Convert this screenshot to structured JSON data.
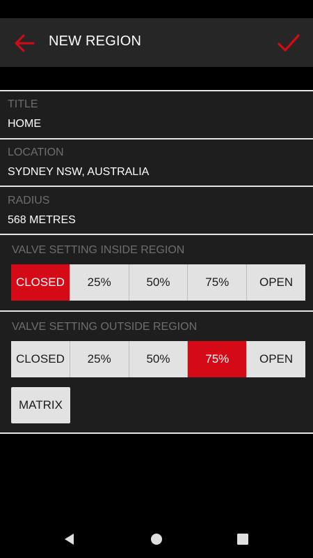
{
  "appbar": {
    "title": "NEW REGION",
    "back_icon": "arrow-left-icon",
    "confirm_icon": "checkmark-icon",
    "accent": "#d50a17"
  },
  "fields": {
    "title": {
      "label": "TITLE",
      "value": "HOME"
    },
    "location": {
      "label": "LOCATION",
      "value": "SYDNEY NSW, AUSTRALIA"
    },
    "radius": {
      "label": "RADIUS",
      "value": "568 METRES"
    }
  },
  "inside": {
    "label": "VALVE SETTING INSIDE REGION",
    "options": [
      "CLOSED",
      "25%",
      "50%",
      "75%",
      "OPEN"
    ],
    "selected": "CLOSED"
  },
  "outside": {
    "label": "VALVE SETTING OUTSIDE REGION",
    "options": [
      "CLOSED",
      "25%",
      "50%",
      "75%",
      "OPEN"
    ],
    "selected": "75%"
  },
  "matrix": {
    "label": "MATRIX"
  },
  "navbar": {
    "back_icon": "triangle-back-icon",
    "home_icon": "circle-home-icon",
    "recents_icon": "square-recents-icon"
  }
}
